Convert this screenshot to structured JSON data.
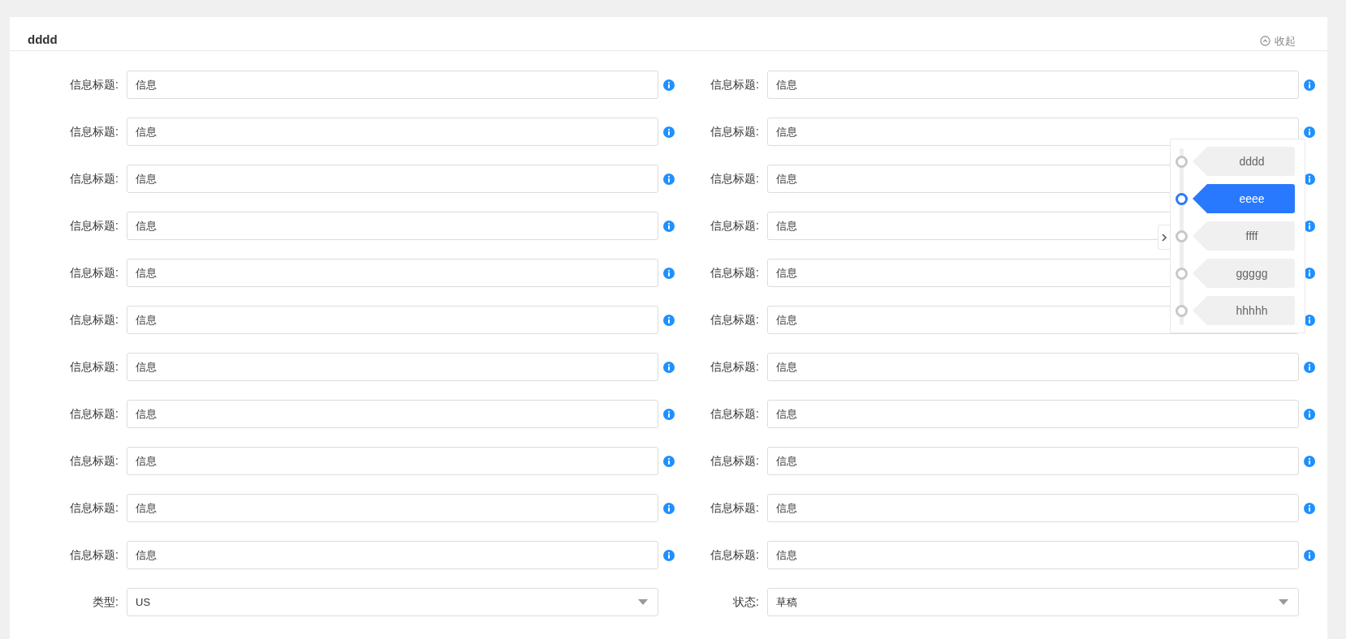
{
  "card": {
    "title": "dddd",
    "collapse_label": "收起"
  },
  "rows": [
    {
      "left": {
        "label": "信息标题:",
        "value": "信息"
      },
      "right": {
        "label": "信息标题:",
        "value": "信息"
      }
    },
    {
      "left": {
        "label": "信息标题:",
        "value": "信息"
      },
      "right": {
        "label": "信息标题:",
        "value": "信息"
      }
    },
    {
      "left": {
        "label": "信息标题:",
        "value": "信息"
      },
      "right": {
        "label": "信息标题:",
        "value": "信息"
      }
    },
    {
      "left": {
        "label": "信息标题:",
        "value": "信息"
      },
      "right": {
        "label": "信息标题:",
        "value": "信息"
      }
    },
    {
      "left": {
        "label": "信息标题:",
        "value": "信息"
      },
      "right": {
        "label": "信息标题:",
        "value": "信息"
      }
    },
    {
      "left": {
        "label": "信息标题:",
        "value": "信息"
      },
      "right": {
        "label": "信息标题:",
        "value": "信息"
      }
    },
    {
      "left": {
        "label": "信息标题:",
        "value": "信息"
      },
      "right": {
        "label": "信息标题:",
        "value": "信息"
      }
    },
    {
      "left": {
        "label": "信息标题:",
        "value": "信息"
      },
      "right": {
        "label": "信息标题:",
        "value": "信息"
      }
    },
    {
      "left": {
        "label": "信息标题:",
        "value": "信息"
      },
      "right": {
        "label": "信息标题:",
        "value": "信息"
      }
    },
    {
      "left": {
        "label": "信息标题:",
        "value": "信息"
      },
      "right": {
        "label": "信息标题:",
        "value": "信息"
      }
    },
    {
      "left": {
        "label": "信息标题:",
        "value": "信息"
      },
      "right": {
        "label": "信息标题:",
        "value": "信息"
      }
    }
  ],
  "selects": {
    "left": {
      "label": "类型:",
      "value": "US"
    },
    "right": {
      "label": "状态:",
      "value": "草稿"
    }
  },
  "anchor_nav": {
    "items": [
      {
        "label": "dddd",
        "selected": false
      },
      {
        "label": "eeee",
        "selected": true
      },
      {
        "label": "ffff",
        "selected": false
      },
      {
        "label": "ggggg",
        "selected": false
      },
      {
        "label": "hhhhh",
        "selected": false
      }
    ]
  }
}
